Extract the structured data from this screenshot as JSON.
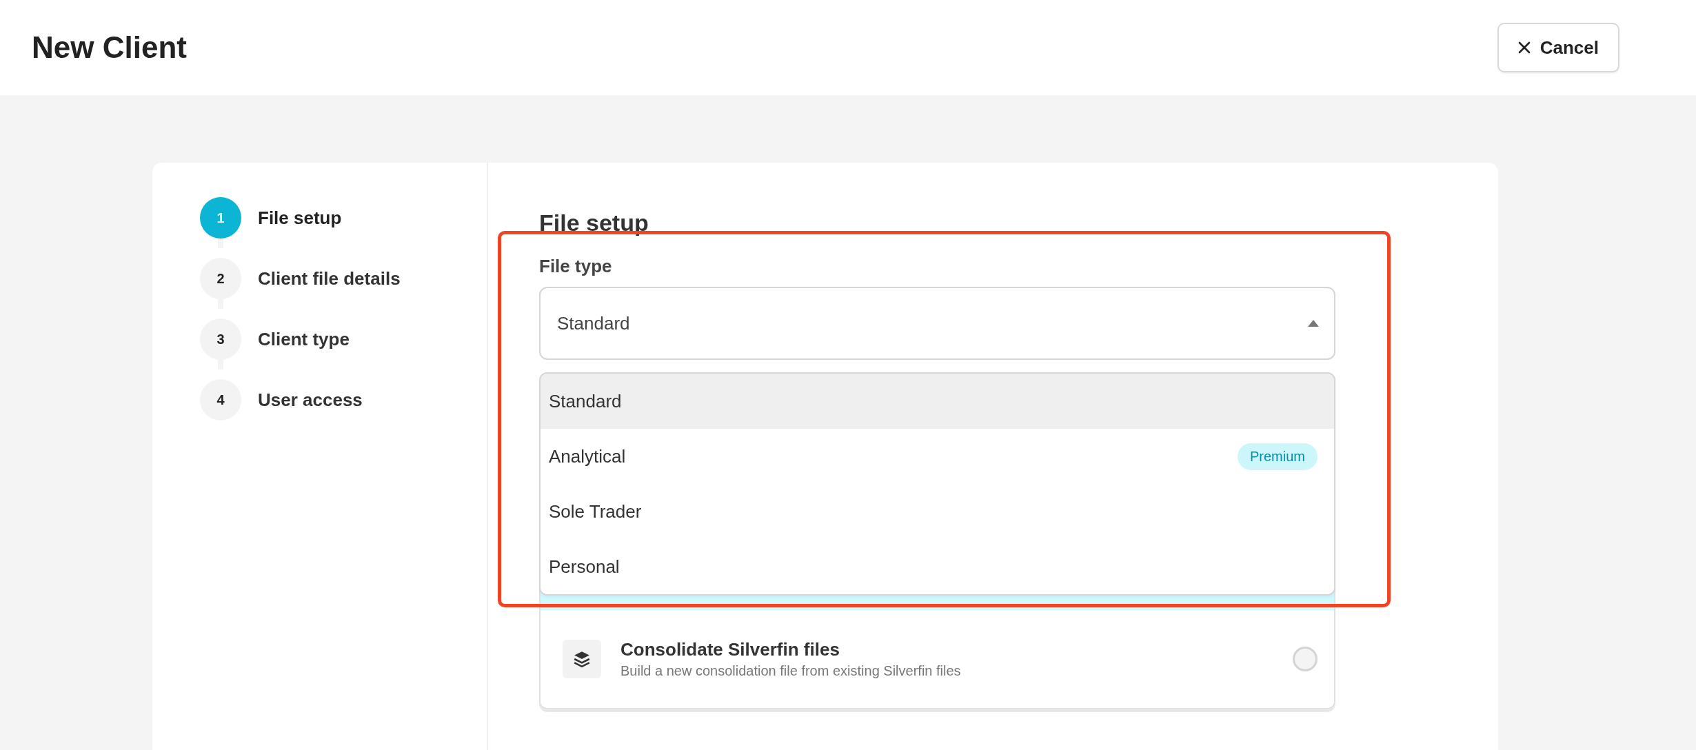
{
  "header": {
    "title": "New Client",
    "cancel_button": "Cancel"
  },
  "steps": [
    {
      "number": "1",
      "label": "File setup",
      "selected": true
    },
    {
      "number": "2",
      "label": "Client file details",
      "selected": false
    },
    {
      "number": "3",
      "label": "Client type",
      "selected": false
    },
    {
      "number": "4",
      "label": "User access",
      "selected": false
    }
  ],
  "section_title": "File setup",
  "file_type": {
    "label": "File type",
    "value": "Standard",
    "expanded": true,
    "options": [
      {
        "label": "Standard",
        "selected": true
      },
      {
        "label": "Analytical",
        "badge": "Premium",
        "selected": false
      },
      {
        "label": "Sole Trader",
        "selected": false
      },
      {
        "label": "Personal",
        "selected": false
      }
    ]
  },
  "file_options": [
    {
      "selected": true
    },
    {
      "title": "Consolidate Silverfin files",
      "description": "Build a new consolidation file from existing Silverfin files",
      "selected": false
    }
  ]
}
